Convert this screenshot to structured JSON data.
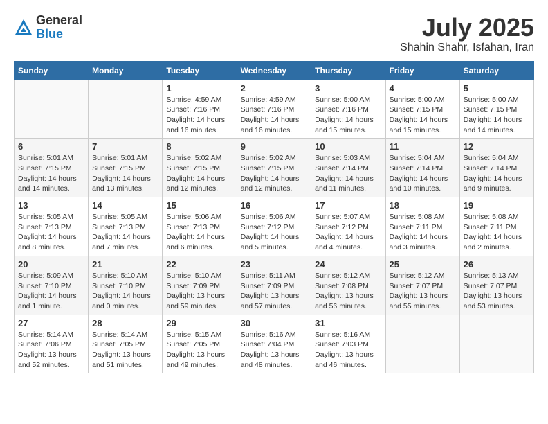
{
  "logo": {
    "general": "General",
    "blue": "Blue"
  },
  "title": "July 2025",
  "subtitle": "Shahin Shahr, Isfahan, Iran",
  "days_header": [
    "Sunday",
    "Monday",
    "Tuesday",
    "Wednesday",
    "Thursday",
    "Friday",
    "Saturday"
  ],
  "weeks": [
    [
      {
        "day": "",
        "info": ""
      },
      {
        "day": "",
        "info": ""
      },
      {
        "day": "1",
        "info": "Sunrise: 4:59 AM\nSunset: 7:16 PM\nDaylight: 14 hours and 16 minutes."
      },
      {
        "day": "2",
        "info": "Sunrise: 4:59 AM\nSunset: 7:16 PM\nDaylight: 14 hours and 16 minutes."
      },
      {
        "day": "3",
        "info": "Sunrise: 5:00 AM\nSunset: 7:16 PM\nDaylight: 14 hours and 15 minutes."
      },
      {
        "day": "4",
        "info": "Sunrise: 5:00 AM\nSunset: 7:15 PM\nDaylight: 14 hours and 15 minutes."
      },
      {
        "day": "5",
        "info": "Sunrise: 5:00 AM\nSunset: 7:15 PM\nDaylight: 14 hours and 14 minutes."
      }
    ],
    [
      {
        "day": "6",
        "info": "Sunrise: 5:01 AM\nSunset: 7:15 PM\nDaylight: 14 hours and 14 minutes."
      },
      {
        "day": "7",
        "info": "Sunrise: 5:01 AM\nSunset: 7:15 PM\nDaylight: 14 hours and 13 minutes."
      },
      {
        "day": "8",
        "info": "Sunrise: 5:02 AM\nSunset: 7:15 PM\nDaylight: 14 hours and 12 minutes."
      },
      {
        "day": "9",
        "info": "Sunrise: 5:02 AM\nSunset: 7:15 PM\nDaylight: 14 hours and 12 minutes."
      },
      {
        "day": "10",
        "info": "Sunrise: 5:03 AM\nSunset: 7:14 PM\nDaylight: 14 hours and 11 minutes."
      },
      {
        "day": "11",
        "info": "Sunrise: 5:04 AM\nSunset: 7:14 PM\nDaylight: 14 hours and 10 minutes."
      },
      {
        "day": "12",
        "info": "Sunrise: 5:04 AM\nSunset: 7:14 PM\nDaylight: 14 hours and 9 minutes."
      }
    ],
    [
      {
        "day": "13",
        "info": "Sunrise: 5:05 AM\nSunset: 7:13 PM\nDaylight: 14 hours and 8 minutes."
      },
      {
        "day": "14",
        "info": "Sunrise: 5:05 AM\nSunset: 7:13 PM\nDaylight: 14 hours and 7 minutes."
      },
      {
        "day": "15",
        "info": "Sunrise: 5:06 AM\nSunset: 7:13 PM\nDaylight: 14 hours and 6 minutes."
      },
      {
        "day": "16",
        "info": "Sunrise: 5:06 AM\nSunset: 7:12 PM\nDaylight: 14 hours and 5 minutes."
      },
      {
        "day": "17",
        "info": "Sunrise: 5:07 AM\nSunset: 7:12 PM\nDaylight: 14 hours and 4 minutes."
      },
      {
        "day": "18",
        "info": "Sunrise: 5:08 AM\nSunset: 7:11 PM\nDaylight: 14 hours and 3 minutes."
      },
      {
        "day": "19",
        "info": "Sunrise: 5:08 AM\nSunset: 7:11 PM\nDaylight: 14 hours and 2 minutes."
      }
    ],
    [
      {
        "day": "20",
        "info": "Sunrise: 5:09 AM\nSunset: 7:10 PM\nDaylight: 14 hours and 1 minute."
      },
      {
        "day": "21",
        "info": "Sunrise: 5:10 AM\nSunset: 7:10 PM\nDaylight: 14 hours and 0 minutes."
      },
      {
        "day": "22",
        "info": "Sunrise: 5:10 AM\nSunset: 7:09 PM\nDaylight: 13 hours and 59 minutes."
      },
      {
        "day": "23",
        "info": "Sunrise: 5:11 AM\nSunset: 7:09 PM\nDaylight: 13 hours and 57 minutes."
      },
      {
        "day": "24",
        "info": "Sunrise: 5:12 AM\nSunset: 7:08 PM\nDaylight: 13 hours and 56 minutes."
      },
      {
        "day": "25",
        "info": "Sunrise: 5:12 AM\nSunset: 7:07 PM\nDaylight: 13 hours and 55 minutes."
      },
      {
        "day": "26",
        "info": "Sunrise: 5:13 AM\nSunset: 7:07 PM\nDaylight: 13 hours and 53 minutes."
      }
    ],
    [
      {
        "day": "27",
        "info": "Sunrise: 5:14 AM\nSunset: 7:06 PM\nDaylight: 13 hours and 52 minutes."
      },
      {
        "day": "28",
        "info": "Sunrise: 5:14 AM\nSunset: 7:05 PM\nDaylight: 13 hours and 51 minutes."
      },
      {
        "day": "29",
        "info": "Sunrise: 5:15 AM\nSunset: 7:05 PM\nDaylight: 13 hours and 49 minutes."
      },
      {
        "day": "30",
        "info": "Sunrise: 5:16 AM\nSunset: 7:04 PM\nDaylight: 13 hours and 48 minutes."
      },
      {
        "day": "31",
        "info": "Sunrise: 5:16 AM\nSunset: 7:03 PM\nDaylight: 13 hours and 46 minutes."
      },
      {
        "day": "",
        "info": ""
      },
      {
        "day": "",
        "info": ""
      }
    ]
  ]
}
